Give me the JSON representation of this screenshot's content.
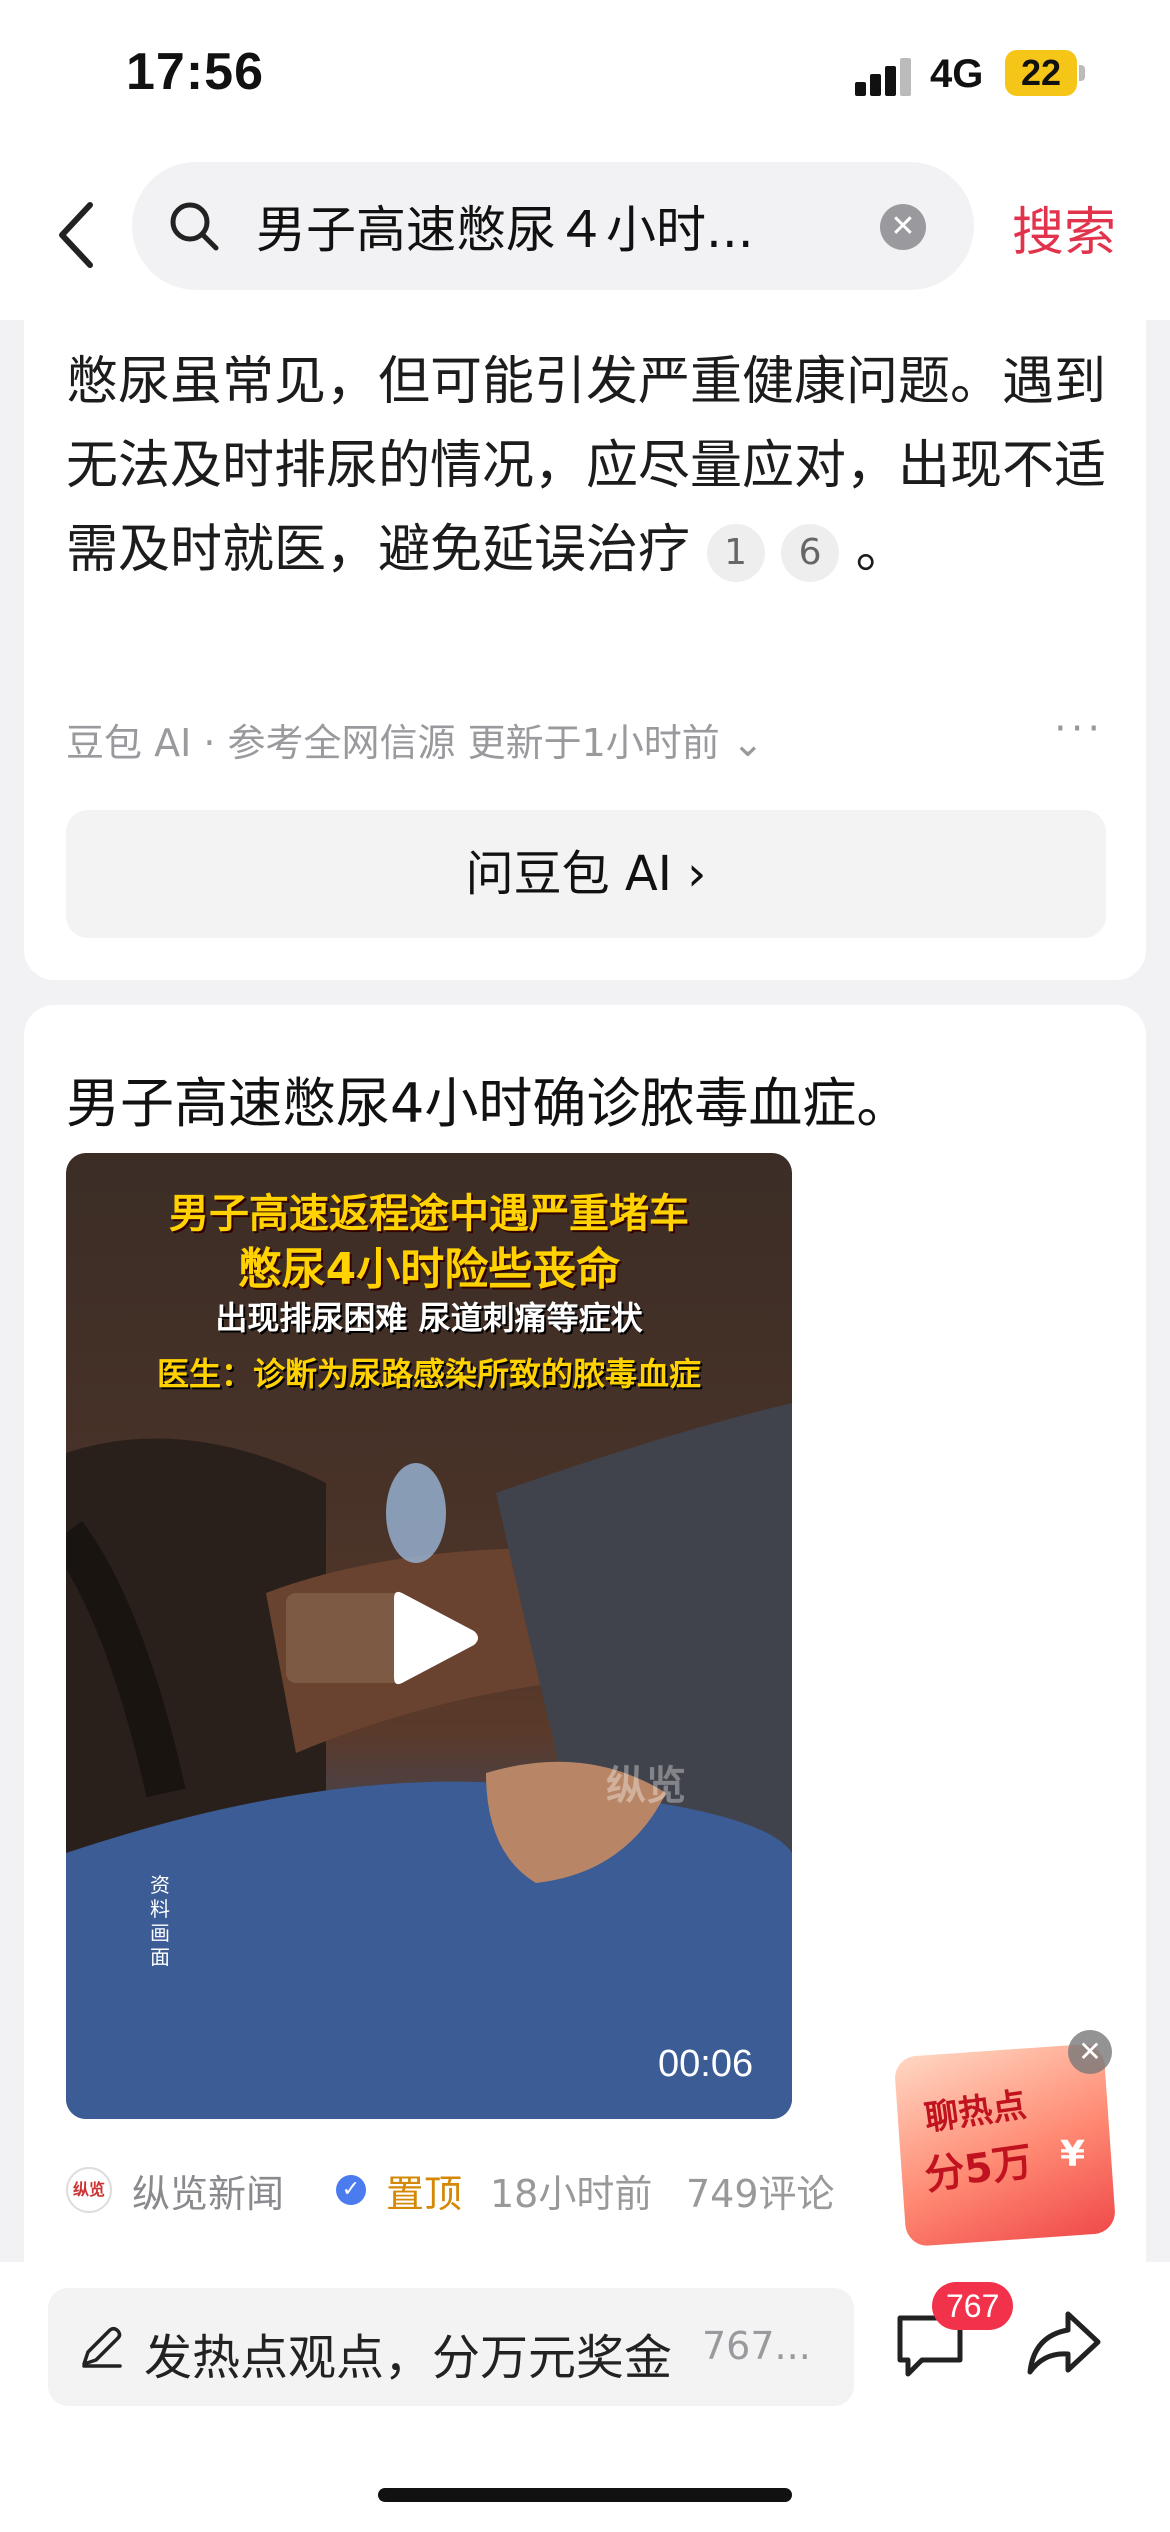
{
  "status_bar": {
    "time": "17:56",
    "network": "4G",
    "battery": "22"
  },
  "search": {
    "query": "男子高速憋尿４小时...",
    "submit_label": "搜索"
  },
  "ai_card": {
    "summary_text": "憋尿虽常见，但可能引发严重健康问题。遇到无法及时排尿的情况，应尽量应对，出现不适需及时就医，避免延误治疗",
    "citation_1": "1",
    "citation_2": "6",
    "tail": " 。",
    "meta": "豆包 AI · 参考全网信源 更新于1小时前",
    "ask_label": "问豆包 AI ›"
  },
  "news_card": {
    "title": "男子高速憋尿4小时确诊脓毒血症。",
    "video": {
      "caption_line1": "男子高速返程途中遇严重堵车",
      "caption_line2": "憋尿4小时险些丧命",
      "caption_line3": "出现排尿困难 尿道刺痛等症状",
      "caption_line4": "医生：诊断为尿路感染所致的脓毒血症",
      "watermark": "纵览",
      "source_note": "资料画面",
      "duration": "00:06"
    },
    "source_logo_text": "纵览",
    "source_name": "纵览新闻",
    "pinned_label": "置顶",
    "age": "18小时前",
    "comments": "749评论"
  },
  "promo": {
    "line1": "聊热点",
    "line2": "分5万",
    "currency": "¥"
  },
  "bottom_bar": {
    "comment_prompt": "发热点观点，分万元奖金",
    "comment_count_text": "767...",
    "comment_badge": "767"
  },
  "colors": {
    "accent_red": "#e1344c",
    "pin_orange": "#d48806",
    "badge_red": "#f2314a"
  },
  "icons": [
    "back-icon",
    "search-icon",
    "clear-icon",
    "more-icon",
    "play-icon",
    "verified-icon",
    "pen-icon",
    "comment-icon",
    "share-icon",
    "close-icon"
  ]
}
